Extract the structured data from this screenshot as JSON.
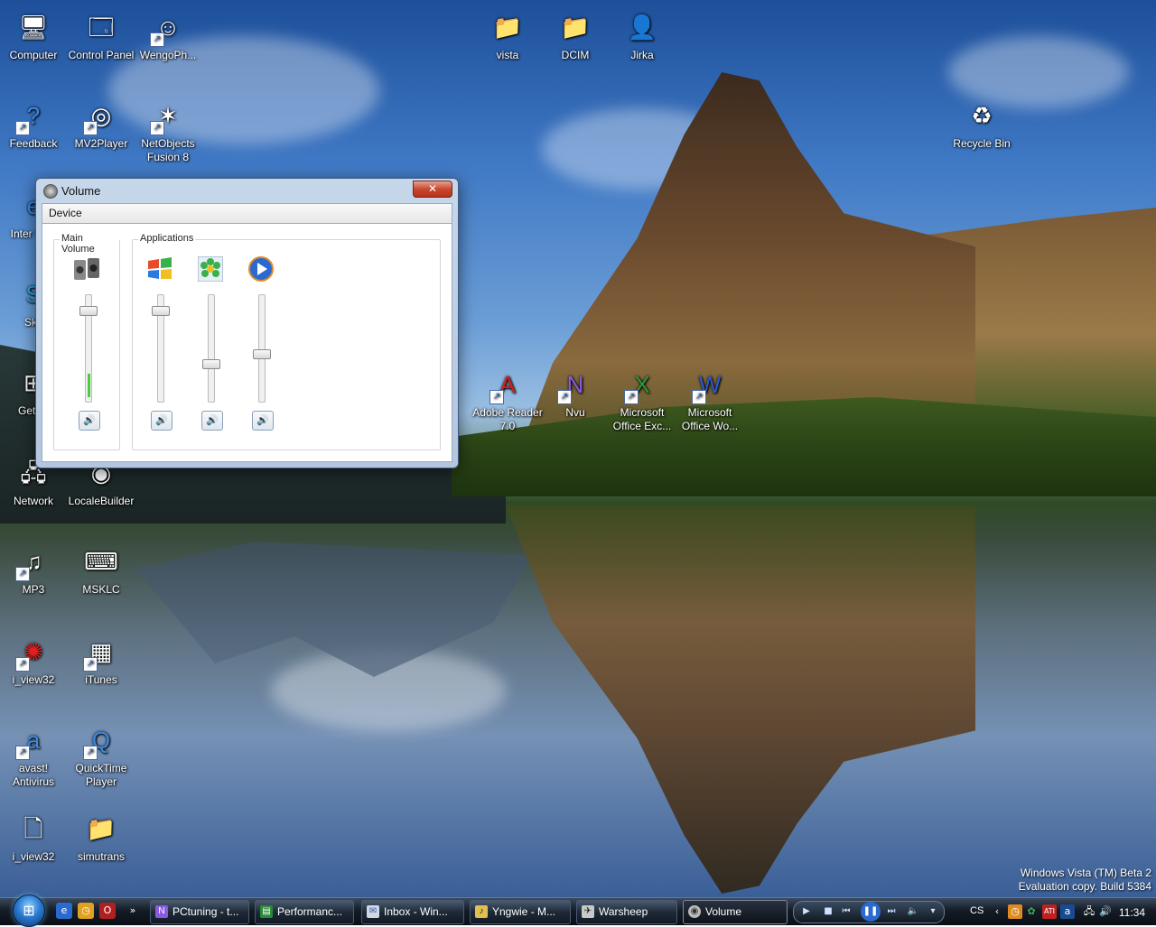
{
  "desktop": {
    "icons": [
      {
        "label": "Computer",
        "glyph": "computer-icon"
      },
      {
        "label": "Control Panel",
        "glyph": "control-panel-icon"
      },
      {
        "label": "WengoPh...",
        "glyph": "wengophone-icon"
      },
      {
        "label": "Feedback",
        "glyph": "help-icon"
      },
      {
        "label": "MV2Player",
        "glyph": "mv2player-icon"
      },
      {
        "label": "NetObjects Fusion 8",
        "glyph": "netobjects-icon"
      },
      {
        "label": "Inter Expl",
        "glyph": "internet-explorer-icon"
      },
      {
        "label": "Sky",
        "glyph": "skype-icon"
      },
      {
        "label": "Get St",
        "glyph": "get-started-icon"
      },
      {
        "label": "Network",
        "glyph": "network-icon"
      },
      {
        "label": "LocaleBuilder",
        "glyph": "localebuilder-icon"
      },
      {
        "label": "MP3",
        "glyph": "mp3-icon"
      },
      {
        "label": "MSKLC",
        "glyph": "keyboard-icon"
      },
      {
        "label": "i_view32",
        "glyph": "irfanview-icon"
      },
      {
        "label": "iTunes",
        "glyph": "itunes-icon"
      },
      {
        "label": "avast! Antivirus",
        "glyph": "avast-icon"
      },
      {
        "label": "QuickTime Player",
        "glyph": "quicktime-icon"
      },
      {
        "label": "i_view32",
        "glyph": "file-icon"
      },
      {
        "label": "simutrans",
        "glyph": "folder-icon"
      },
      {
        "label": "vista",
        "glyph": "folder-icon"
      },
      {
        "label": "DCIM",
        "glyph": "folder-icon"
      },
      {
        "label": "Jirka",
        "glyph": "user-folder-icon"
      },
      {
        "label": "Recycle Bin",
        "glyph": "recycle-bin-icon"
      },
      {
        "label": "Adobe Reader 7.0",
        "glyph": "adobe-reader-icon"
      },
      {
        "label": "Nvu",
        "glyph": "nvu-icon"
      },
      {
        "label": "Microsoft Office Exc...",
        "glyph": "excel-icon"
      },
      {
        "label": "Microsoft Office Wo...",
        "glyph": "word-icon"
      }
    ],
    "watermark_line1": "Windows Vista (TM) Beta 2",
    "watermark_line2": "Evaluation copy. Build 5384"
  },
  "volume_window": {
    "title": "Volume",
    "close_glyph": "✕",
    "menu": "Device",
    "main_group_title": "Main Volume",
    "apps_group_title": "Applications",
    "main_level": 0.9,
    "app_levels": [
      0.9,
      0.35,
      0.45
    ],
    "mute_glyph": "🔊"
  },
  "taskbar": {
    "tasks": [
      {
        "label": "PCtuning - t...",
        "icon": "nvu-icon"
      },
      {
        "label": "Performanc...",
        "icon": "performance-icon"
      },
      {
        "label": "Inbox - Win...",
        "icon": "mail-icon"
      },
      {
        "label": "Yngwie - M...",
        "icon": "media-icon"
      },
      {
        "label": "Warsheep",
        "icon": "warsheep-icon"
      },
      {
        "label": "Volume",
        "icon": "volume-icon"
      }
    ],
    "language": "CS",
    "clock": "11:34"
  },
  "colors": {
    "accent": "#2a7ad0",
    "close": "#c9482e",
    "meter": "#4ccc3a"
  }
}
